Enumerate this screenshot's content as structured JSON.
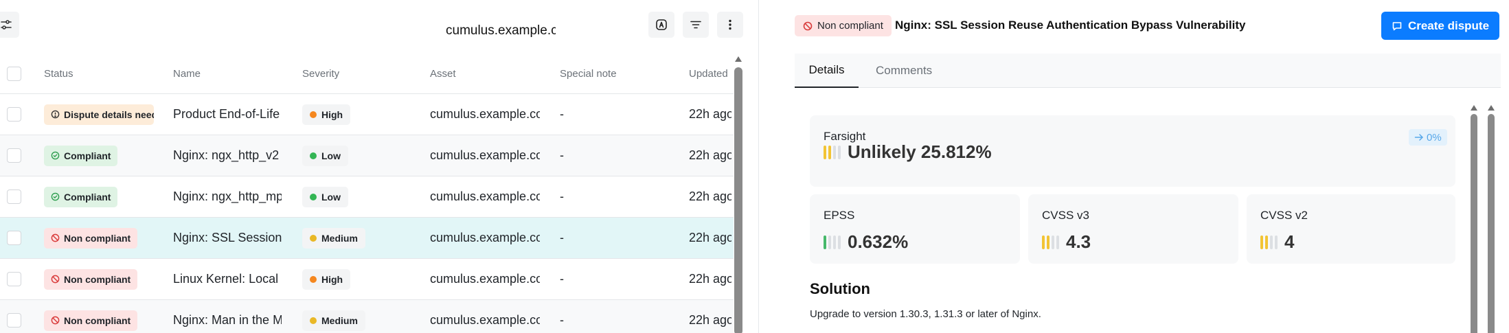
{
  "toolbar": {
    "title": "cumulus.example.com"
  },
  "table": {
    "headers": {
      "status": "Status",
      "name": "Name",
      "severity": "Severity",
      "asset": "Asset",
      "note": "Special note",
      "updated": "Updated"
    },
    "rows": [
      {
        "status": "Dispute details needed",
        "status_kind": "dispute",
        "name": "Product End-of-Life",
        "severity": "High",
        "severity_color": "#f5871f",
        "asset": "cumulus.example.com",
        "note": "-",
        "updated": "22h ago"
      },
      {
        "status": "Compliant",
        "status_kind": "compliant",
        "name": "Nginx: ngx_http_v2",
        "severity": "Low",
        "severity_color": "#33b554",
        "asset": "cumulus.example.com",
        "note": "-",
        "updated": "22h ago"
      },
      {
        "status": "Compliant",
        "status_kind": "compliant",
        "name": "Nginx: ngx_http_mp",
        "severity": "Low",
        "severity_color": "#33b554",
        "asset": "cumulus.example.com",
        "note": "-",
        "updated": "22h ago"
      },
      {
        "status": "Non compliant",
        "status_kind": "noncompliant",
        "name": "Nginx: SSL Session",
        "severity": "Medium",
        "severity_color": "#e9b826",
        "asset": "cumulus.example.com",
        "note": "-",
        "updated": "22h ago"
      },
      {
        "status": "Non compliant",
        "status_kind": "noncompliant",
        "name": "Linux Kernel: Local",
        "severity": "High",
        "severity_color": "#f5871f",
        "asset": "cumulus.example.com",
        "note": "-",
        "updated": "22h ago"
      },
      {
        "status": "Non compliant",
        "status_kind": "noncompliant",
        "name": "Nginx: Man in the M",
        "severity": "Medium",
        "severity_color": "#e9b826",
        "asset": "cumulus.example.com",
        "note": "-",
        "updated": "22h ago"
      }
    ]
  },
  "detail": {
    "status": "Non compliant",
    "title": "Nginx: SSL Session Reuse Authentication Bypass Vulnerability",
    "create_dispute_label": "Create dispute",
    "tabs": [
      {
        "label": "Details",
        "active": true
      },
      {
        "label": "Comments",
        "active": false
      }
    ],
    "farsight": {
      "label": "Farsight",
      "value": "Unlikely 25.812%",
      "trend": "0%",
      "bar_level": 2
    },
    "epss": {
      "label": "EPSS",
      "value": "0.632%",
      "bar_level": 1
    },
    "cvss_v3": {
      "label": "CVSS v3",
      "value": "4.3",
      "bar_level": 2
    },
    "cvss_v2": {
      "label": "CVSS v2",
      "value": "4",
      "bar_level": 2
    },
    "solution": {
      "title": "Solution",
      "text": "Upgrade to version 1.30.3, 1.31.3 or later of Nginx."
    }
  },
  "colors": {
    "accent": "#0b7cff",
    "selected_row": "#e2f6f7",
    "non_compliant_bg": "#fde3e3",
    "compliant_bg": "#dff3e4",
    "dispute_bg": "#fdecd9"
  }
}
